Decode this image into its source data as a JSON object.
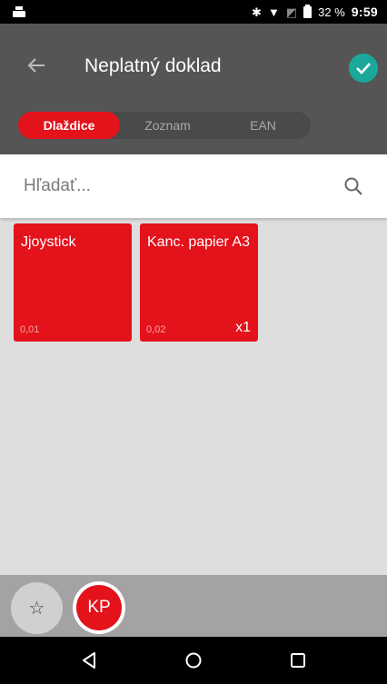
{
  "status": {
    "battery_percent": "32 %",
    "time": "9:59"
  },
  "toolbar": {
    "title": "Neplatný doklad"
  },
  "view_tabs": [
    {
      "label": "Dlaždice",
      "active": true
    },
    {
      "label": "Zoznam",
      "active": false
    },
    {
      "label": "EAN",
      "active": false
    }
  ],
  "search": {
    "placeholder": "Hľadať..."
  },
  "tiles": [
    {
      "name": "Jjoystick",
      "price": "0,01",
      "qty": ""
    },
    {
      "name": "Kanc. papier A3",
      "price": "0,02",
      "qty": "x1"
    }
  ],
  "bottom": {
    "favorites_icon": "☆",
    "user_initials": "KP"
  },
  "colors": {
    "accent": "#e3121b",
    "confirm": "#1aa89a",
    "toolbar": "#555556"
  }
}
